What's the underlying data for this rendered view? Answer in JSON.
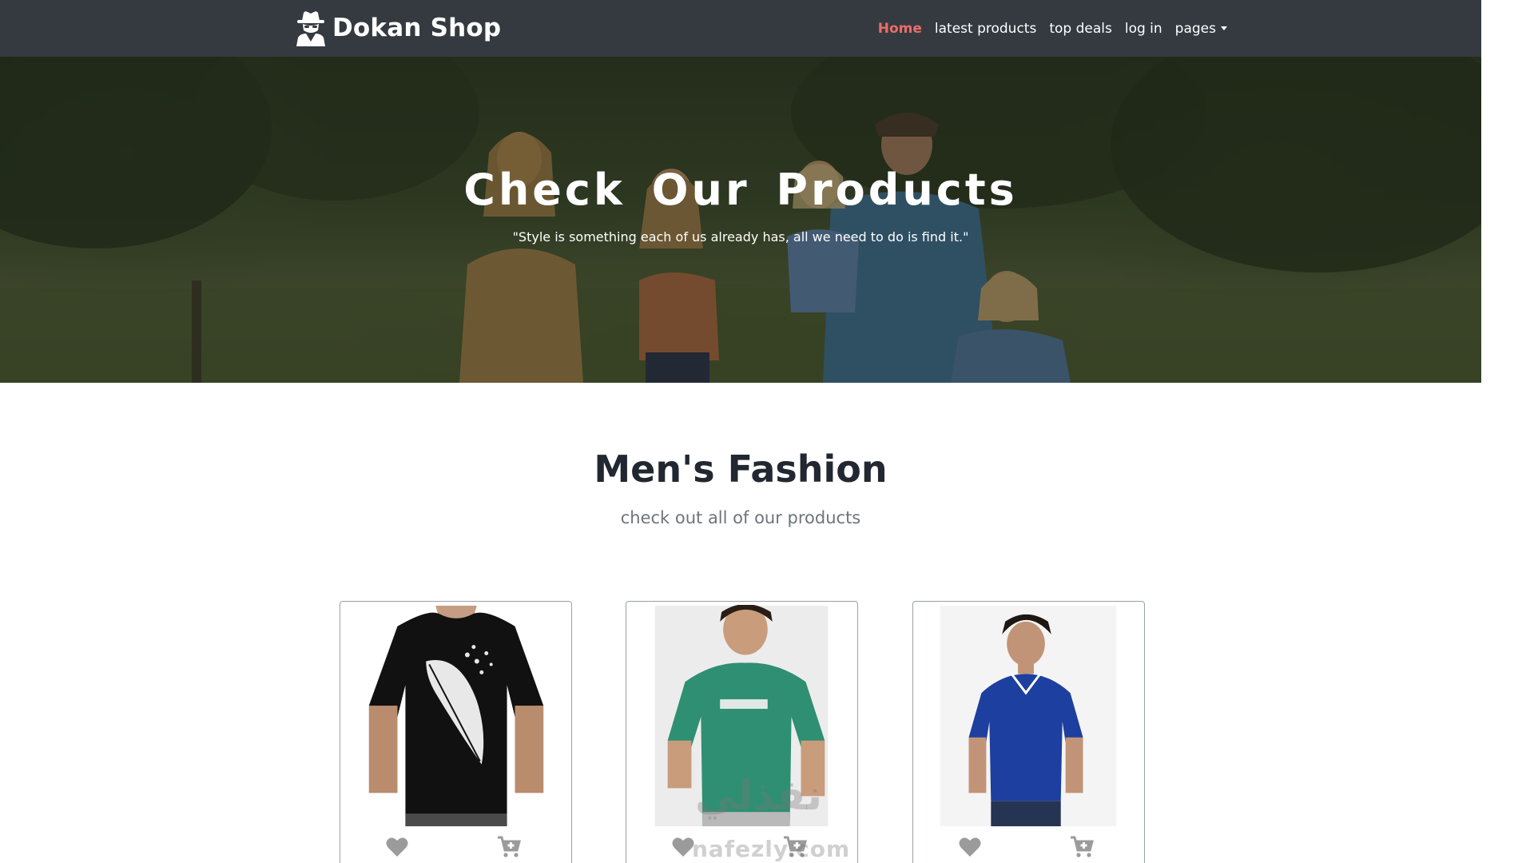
{
  "navbar": {
    "brand": "Dokan Shop",
    "brand_icon": "spy-icon",
    "links": [
      {
        "label": "Home",
        "active": true
      },
      {
        "label": "latest products",
        "active": false
      },
      {
        "label": "top deals",
        "active": false
      },
      {
        "label": "log in",
        "active": false
      },
      {
        "label": "pages",
        "active": false,
        "dropdown": true
      }
    ]
  },
  "hero": {
    "title": "Check Our Products",
    "subtitle": "\"Style is something each of us already has, all we need to do is find it.\""
  },
  "section": {
    "title": "Men's Fashion",
    "subtitle": "check out all of our products"
  },
  "products": [
    {
      "name": "black-tshirt-feather",
      "shirt_color": "#111111",
      "actions": [
        "heart-icon",
        "cart-plus-icon"
      ]
    },
    {
      "name": "green-tshirt",
      "shirt_color": "#2f8f72",
      "actions": [
        "heart-icon",
        "cart-plus-icon"
      ]
    },
    {
      "name": "blue-polo",
      "shirt_color": "#1d3f9f",
      "actions": [
        "heart-icon",
        "cart-plus-icon"
      ]
    }
  ],
  "watermark": {
    "arabic": "نفذلي",
    "latin": "nafezly.com"
  },
  "colors": {
    "navbar": "#343a40",
    "active_link": "#ee6b66",
    "icon_gray": "#9b9b9b"
  }
}
